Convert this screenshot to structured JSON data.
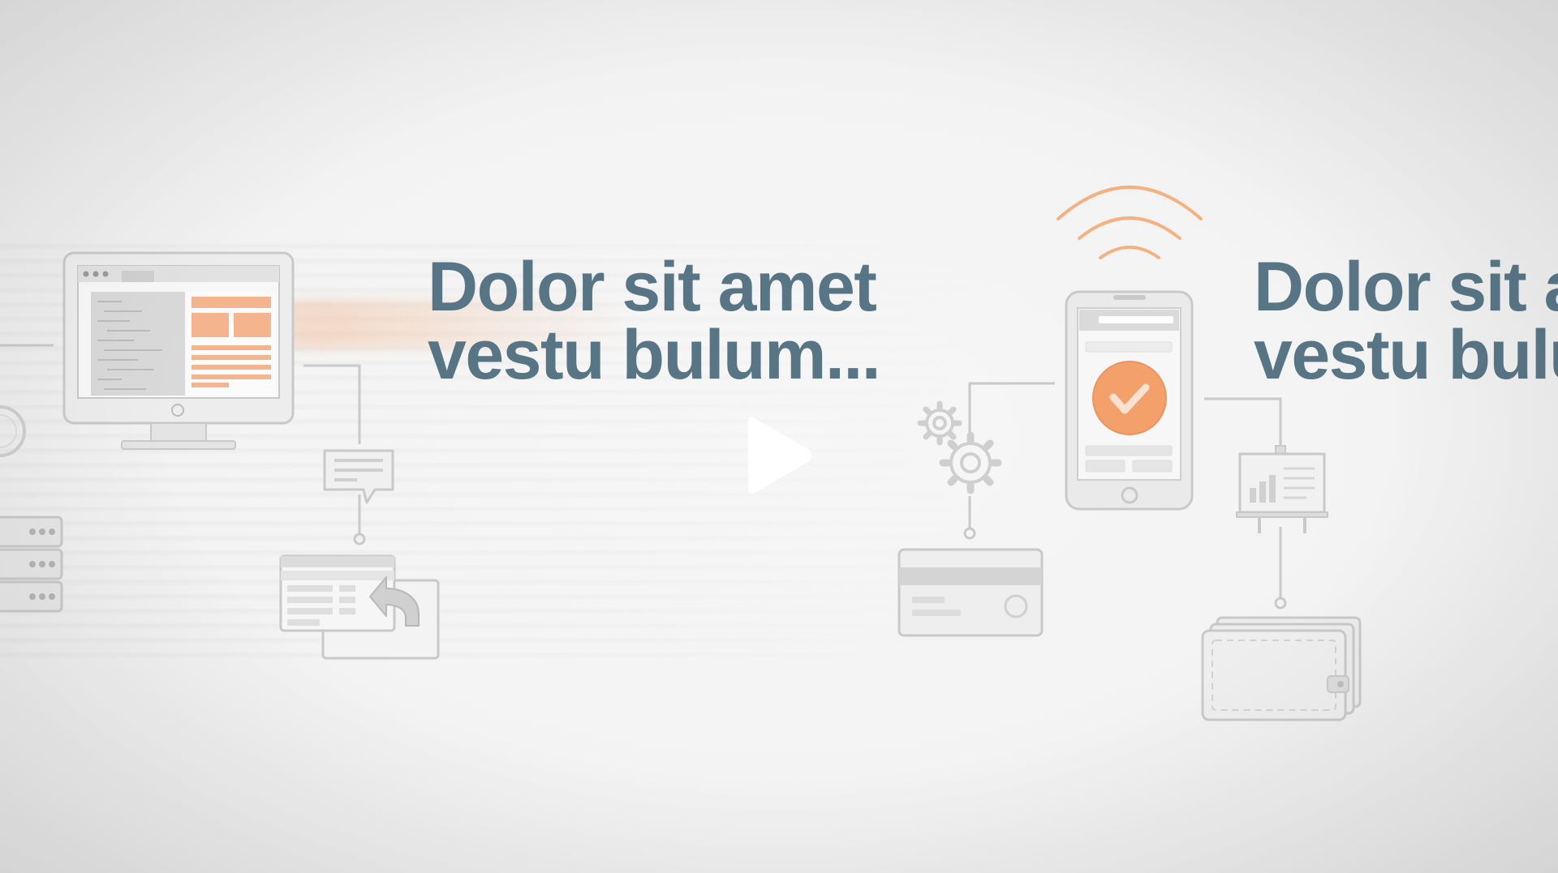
{
  "slides": [
    {
      "title_line1": "Dolor sit amet",
      "title_line2": "vestu bulum..."
    },
    {
      "title_line1": "Dolor sit amet",
      "title_line2": "vestu bulum..."
    }
  ],
  "colors": {
    "headline": "#587586",
    "accent_orange": "#f4a06a",
    "icon_gray": "#c9c9c9",
    "background": "#f3f3f3"
  },
  "player": {
    "control": "play-icon"
  },
  "icons": [
    "desktop-monitor-icon",
    "server-stack-icon",
    "gauge-icon",
    "chat-bubble-icon",
    "window-return-icon",
    "wifi-signal-icon",
    "smartphone-check-icon",
    "gears-icon",
    "credit-card-icon",
    "presentation-board-icon",
    "wallet-icon"
  ]
}
